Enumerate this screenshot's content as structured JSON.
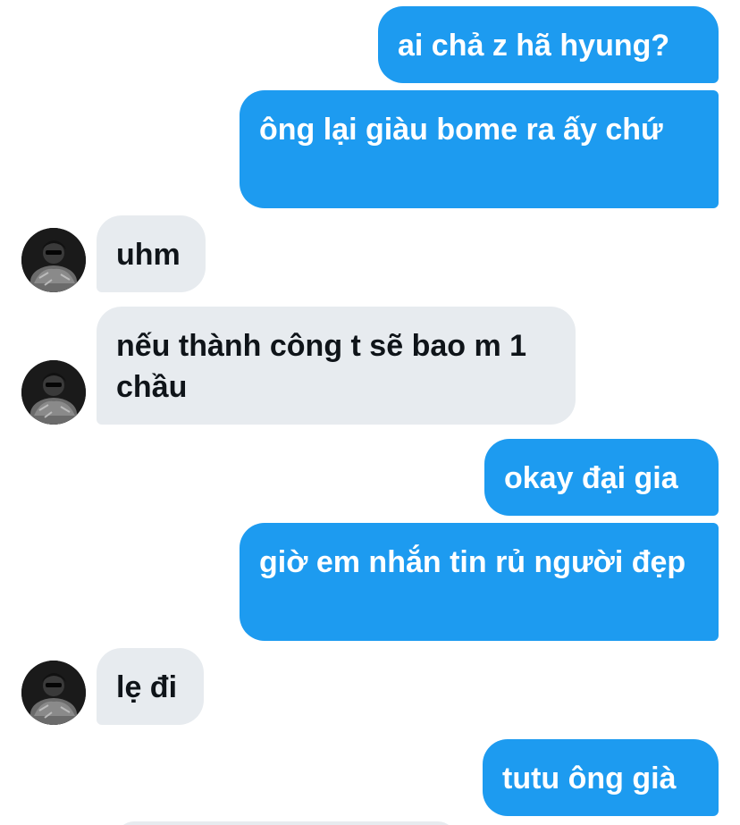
{
  "conversation": {
    "messages": [
      {
        "direction": "outgoing",
        "text": "ai chả z hã hyung?"
      },
      {
        "direction": "outgoing",
        "text": "ông lại giàu bome ra ấy chứ"
      },
      {
        "direction": "incoming",
        "text": "uhm"
      },
      {
        "direction": "incoming",
        "text": "nếu thành công t sẽ bao m 1 chầu"
      },
      {
        "direction": "outgoing",
        "text": "okay đại gia"
      },
      {
        "direction": "outgoing",
        "text": "giờ em nhắn tin rủ người đẹp"
      },
      {
        "direction": "incoming",
        "text": "lẹ đi"
      },
      {
        "direction": "outgoing",
        "text": "tutu ông già"
      }
    ]
  },
  "colors": {
    "outgoing_bubble": "#1d9bf0",
    "incoming_bubble": "#e7ebef",
    "outgoing_text": "#ffffff",
    "incoming_text": "#0f1419"
  },
  "icons": {
    "contact_avatar": "avatar-photo"
  }
}
